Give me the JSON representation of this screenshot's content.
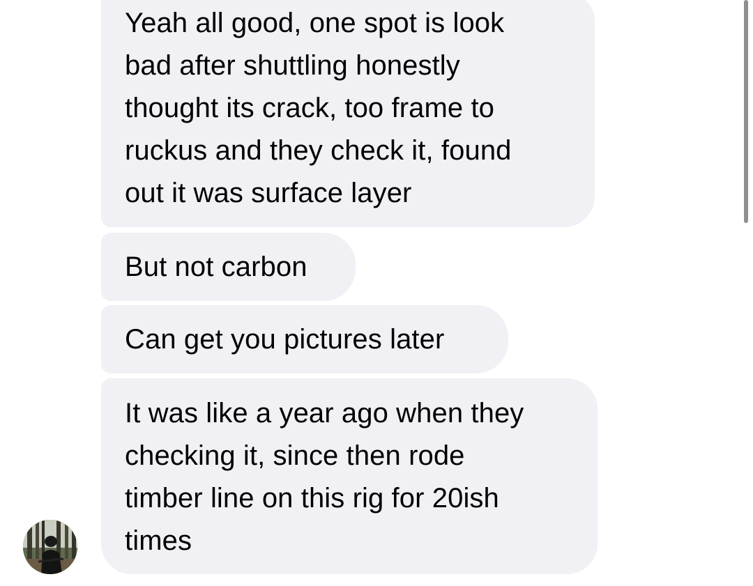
{
  "thread": {
    "messages": [
      {
        "text": "Yeah all good, one spot is look\nbad after shuttling honestly\nthought its crack, too frame to\nruckus and they check it, found\nout it was surface layer"
      },
      {
        "text": "But not carbon"
      },
      {
        "text": "Can get you pictures later"
      },
      {
        "text": "It was like a year ago when they\nchecking it, since then rode\ntimber line on this rig for 20ish\ntimes"
      }
    ]
  },
  "sender": {
    "avatar_icon": "profile-photo-forest-rider"
  },
  "colors": {
    "bubble_background": "#f0f0f5",
    "page_background": "#ffffff",
    "text": "#000000",
    "scrollbar": "#8e8e93"
  }
}
